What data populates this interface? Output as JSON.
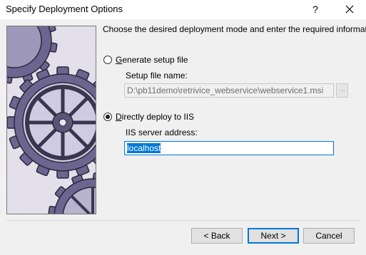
{
  "window": {
    "title": "Specify Deployment Options"
  },
  "titlebar": {
    "help_label": "?"
  },
  "main": {
    "instruction": "Choose the desired deployment mode and enter the required information",
    "option_setup": {
      "label_first": "G",
      "label_rest": "enerate setup file",
      "checked": false,
      "field_label": "Setup file name:",
      "field_value": "D:\\pb11demo\\retrivice_webservice\\webservice1.msi",
      "browse_label": "..."
    },
    "option_iis": {
      "label_first": "D",
      "label_rest": "irectly deploy to IIS",
      "checked": true,
      "field_label": "IIS server address:",
      "field_value": "localhost"
    }
  },
  "footer": {
    "back_label": "< Back",
    "next_label": "Next >",
    "cancel_label": "Cancel"
  }
}
